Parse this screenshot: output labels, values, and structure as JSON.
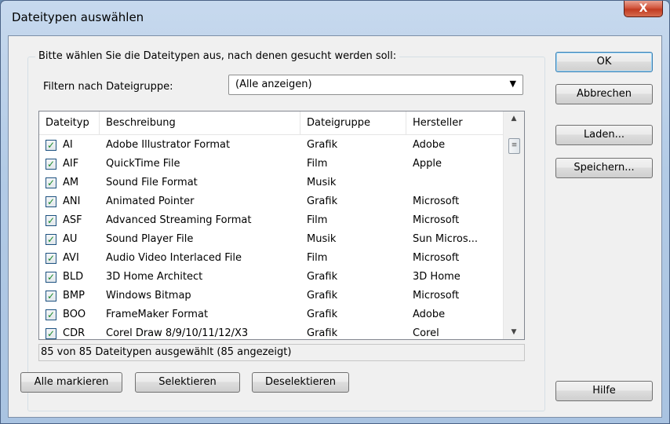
{
  "window": {
    "title": "Dateitypen auswählen",
    "close_symbol": "X"
  },
  "group": {
    "label": "Bitte wählen Sie die Dateitypen aus, nach denen gesucht werden soll:"
  },
  "filter": {
    "label": "Filtern nach Dateigruppe:",
    "value": "(Alle anzeigen)",
    "arrow": "▼"
  },
  "table": {
    "columns": [
      "Dateityp",
      "Beschreibung",
      "Dateigruppe",
      "Hersteller"
    ],
    "rows": [
      {
        "checked": "✓",
        "type": "AI",
        "desc": "Adobe Illustrator Format",
        "group": "Grafik",
        "vendor": "Adobe"
      },
      {
        "checked": "✓",
        "type": "AIF",
        "desc": "QuickTime File",
        "group": "Film",
        "vendor": "Apple"
      },
      {
        "checked": "✓",
        "type": "AM",
        "desc": "Sound File Format",
        "group": "Musik",
        "vendor": ""
      },
      {
        "checked": "✓",
        "type": "ANI",
        "desc": "Animated Pointer",
        "group": "Grafik",
        "vendor": "Microsoft"
      },
      {
        "checked": "✓",
        "type": "ASF",
        "desc": "Advanced Streaming Format",
        "group": "Film",
        "vendor": "Microsoft"
      },
      {
        "checked": "✓",
        "type": "AU",
        "desc": "Sound Player File",
        "group": "Musik",
        "vendor": "Sun Micros..."
      },
      {
        "checked": "✓",
        "type": "AVI",
        "desc": "Audio Video Interlaced File",
        "group": "Film",
        "vendor": "Microsoft"
      },
      {
        "checked": "✓",
        "type": "BLD",
        "desc": "3D Home Architect",
        "group": "Grafik",
        "vendor": "3D Home"
      },
      {
        "checked": "✓",
        "type": "BMP",
        "desc": "Windows Bitmap",
        "group": "Grafik",
        "vendor": "Microsoft"
      },
      {
        "checked": "✓",
        "type": "BOO",
        "desc": "FrameMaker Format",
        "group": "Grafik",
        "vendor": "Adobe"
      },
      {
        "checked": "✓",
        "type": "CDR",
        "desc": "Corel Draw 8/9/10/11/12/X3",
        "group": "Grafik",
        "vendor": "Corel"
      }
    ],
    "scroll_up": "▲",
    "scroll_down": "▼",
    "thumb_grip": "≡"
  },
  "status": {
    "text": "85 von 85 Dateitypen ausgewählt (85 angezeigt)"
  },
  "buttons": {
    "ok": "OK",
    "cancel": "Abbrechen",
    "load": "Laden...",
    "save": "Speichern...",
    "select_all": "Alle markieren",
    "select": "Selektieren",
    "deselect": "Deselektieren",
    "help": "Hilfe"
  }
}
